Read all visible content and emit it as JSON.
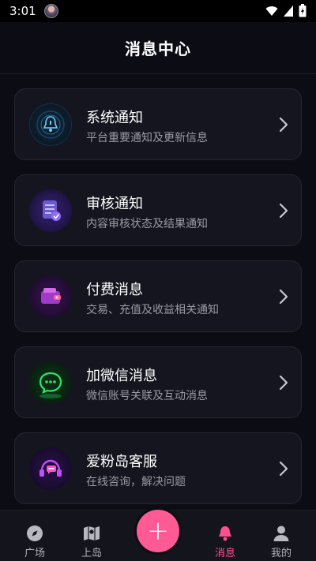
{
  "status_bar": {
    "time": "3:01"
  },
  "header": {
    "title": "消息中心"
  },
  "items": [
    {
      "title": "系统通知",
      "subtitle": "平台重要通知及更新信息",
      "icon": "bell-shield-icon"
    },
    {
      "title": "审核通知",
      "subtitle": "内容审核状态及结果通知",
      "icon": "document-check-icon"
    },
    {
      "title": "付费消息",
      "subtitle": "交易、充值及收益相关通知",
      "icon": "wallet-icon"
    },
    {
      "title": "加微信消息",
      "subtitle": "微信账号关联及互动消息",
      "icon": "wechat-chat-icon"
    },
    {
      "title": "爱粉岛客服",
      "subtitle": "在线咨询，解决问题",
      "icon": "headset-icon"
    }
  ],
  "nav": {
    "items": [
      {
        "label": "广场",
        "icon": "compass-icon"
      },
      {
        "label": "上岛",
        "icon": "map-icon"
      },
      {
        "label": "消息",
        "icon": "bell-icon",
        "active": true
      },
      {
        "label": "我的",
        "icon": "person-icon"
      }
    ],
    "fab_label": "+"
  },
  "colors": {
    "accent": "#ff5a94",
    "background": "#0c0c14",
    "card": "#15151f"
  }
}
